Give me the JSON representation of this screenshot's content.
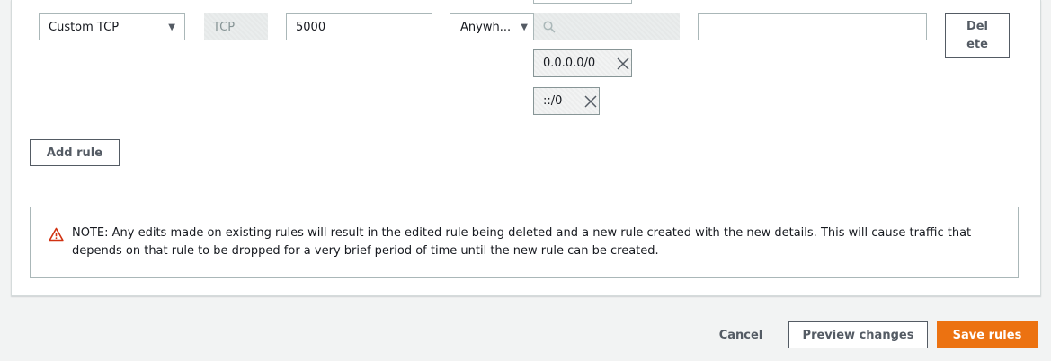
{
  "rule": {
    "type_value": "Custom TCP",
    "protocol_value": "TCP",
    "port_value": "5000",
    "source_value": "Anywh...",
    "search_placeholder": "",
    "cidr_tokens": [
      "0.0.0.0/0",
      "::/0"
    ],
    "description_value": "",
    "delete_label_line1": "Del",
    "delete_label_line2": "ete"
  },
  "add_rule_label": "Add rule",
  "note_text": "NOTE: Any edits made on existing rules will result in the edited rule being deleted and a new rule created with the new details. This will cause traffic that depends on that rule to be dropped for a very brief period of time until the new rule can be created.",
  "footer": {
    "cancel_label": "Cancel",
    "preview_label": "Preview changes",
    "save_label": "Save rules"
  },
  "icons": {
    "caret": "caret-down-icon",
    "search": "search-icon",
    "close": "close-icon",
    "warning": "warning-icon"
  },
  "colors": {
    "primary": "#ec7211",
    "warning": "#d13212",
    "border": "#aab7b8"
  }
}
